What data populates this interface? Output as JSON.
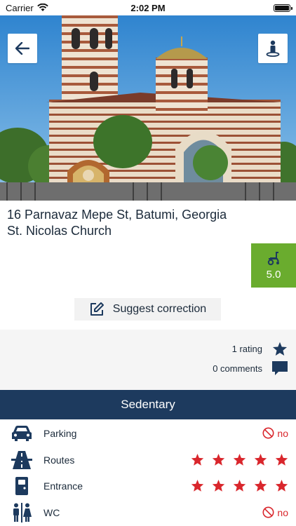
{
  "status_bar": {
    "carrier": "Carrier",
    "time": "2:02 PM"
  },
  "hero": {
    "back_icon": "arrow-left-icon",
    "person_icon": "person-location-icon"
  },
  "place": {
    "address": "16 Parnavaz Mepe St, Batumi, Georgia",
    "name": "St. Nicolas Church"
  },
  "rating_badge": {
    "icon": "wheelchair-icon",
    "score": "5.0",
    "color": "#6aac2e"
  },
  "suggest": {
    "label": "Suggest correction",
    "icon": "edit-icon"
  },
  "stats": {
    "ratings_text": "1 rating",
    "comments_text": "0 comments"
  },
  "section": {
    "title": "Sedentary",
    "color": "#1d3a5e"
  },
  "features": [
    {
      "label": "Parking",
      "icon": "car-icon",
      "value_type": "no",
      "value_text": "no"
    },
    {
      "label": "Routes",
      "icon": "road-icon",
      "value_type": "stars",
      "stars": 5
    },
    {
      "label": "Entrance",
      "icon": "door-icon",
      "value_type": "stars",
      "stars": 5
    },
    {
      "label": "WC",
      "icon": "restroom-icon",
      "value_type": "no",
      "value_text": "no"
    }
  ],
  "colors": {
    "accent_red": "#d9262c",
    "navy": "#1d3a5e"
  }
}
